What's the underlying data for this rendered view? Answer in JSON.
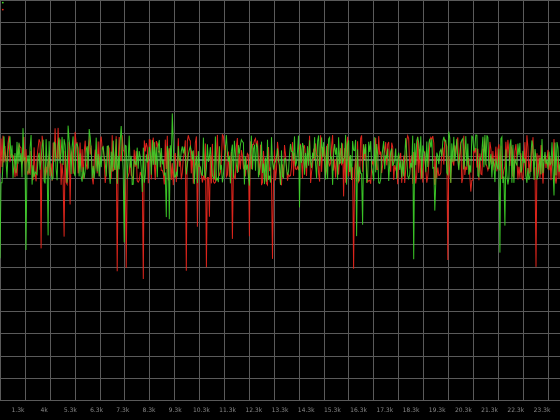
{
  "chart_data": {
    "type": "line",
    "title": "",
    "xlabel": "",
    "ylabel": "",
    "x_tick_labels": [
      "1.3k",
      "4k",
      "5.3k",
      "6.3k",
      "7.3k",
      "8.3k",
      "9.3k",
      "10.3k",
      "11.3k",
      "12.3k",
      "13.3k",
      "14.3k",
      "15.3k",
      "16.3k",
      "17.3k",
      "18.3k",
      "19.3k",
      "20.3k",
      "21.3k",
      "22.3k",
      "23.3k"
    ],
    "x_range": [
      0,
      1
    ],
    "ylim": [
      -2.1,
      1.4
    ],
    "grid": true,
    "legend": "top-left",
    "series": [
      {
        "name": "",
        "color": "#e8261c",
        "samples": 560,
        "baseline": 0,
        "amplitude": 0.22,
        "seed": 7
      },
      {
        "name": "",
        "color": "#3fd62a",
        "samples": 560,
        "baseline": 0,
        "amplitude": 0.22,
        "seed": 19
      }
    ],
    "reference_line": 0
  },
  "colors": {
    "background": "#000000",
    "grid": "#5a5a5a",
    "reference": "#d0d0d0",
    "axis_text": "#8a8a8a"
  },
  "legend_items": [
    {
      "icon": "green-channel-marker",
      "color": "#3fd62a"
    },
    {
      "icon": "red-channel-marker",
      "color": "#e8261c"
    }
  ]
}
